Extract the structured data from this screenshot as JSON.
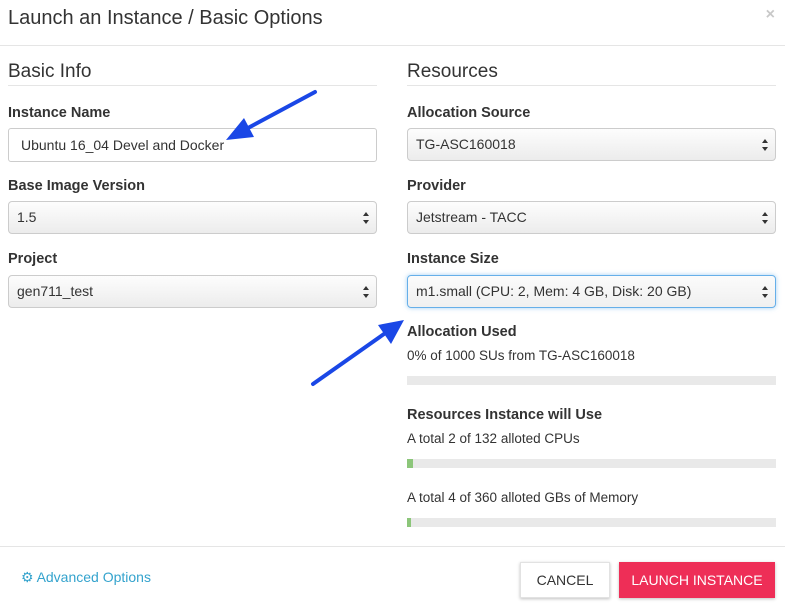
{
  "modal": {
    "title": "Launch an Instance / Basic Options",
    "close_glyph": "×"
  },
  "basic_info": {
    "heading": "Basic Info",
    "instance_name": {
      "label": "Instance Name",
      "value": "Ubuntu 16_04 Devel and Docker"
    },
    "base_image_version": {
      "label": "Base Image Version",
      "value": "1.5"
    },
    "project": {
      "label": "Project",
      "value": "gen711_test"
    }
  },
  "resources": {
    "heading": "Resources",
    "allocation_source": {
      "label": "Allocation Source",
      "value": "TG-ASC160018"
    },
    "provider": {
      "label": "Provider",
      "value": "Jetstream - TACC"
    },
    "instance_size": {
      "label": "Instance Size",
      "value": "m1.small (CPU: 2, Mem: 4 GB, Disk: 20 GB)"
    },
    "allocation_used": {
      "label": "Allocation Used",
      "text": "0% of 1000 SUs from TG-ASC160018",
      "percent": 0
    },
    "will_use": {
      "label": "Resources Instance will Use",
      "cpu_text": "A total 2 of 132 alloted CPUs",
      "cpu_used": 2,
      "cpu_total": 132,
      "memory_text": "A total 4 of 360 alloted GBs of Memory",
      "memory_used": 4,
      "memory_total": 360
    }
  },
  "footer": {
    "advanced_options": "Advanced Options",
    "cancel": "CANCEL",
    "launch": "LAUNCH INSTANCE"
  },
  "colors": {
    "accent": "#34a3cd",
    "launch": "#ee2e57",
    "progress_fill": "#8cc67a",
    "annotation_arrow": "#1a47e6"
  }
}
